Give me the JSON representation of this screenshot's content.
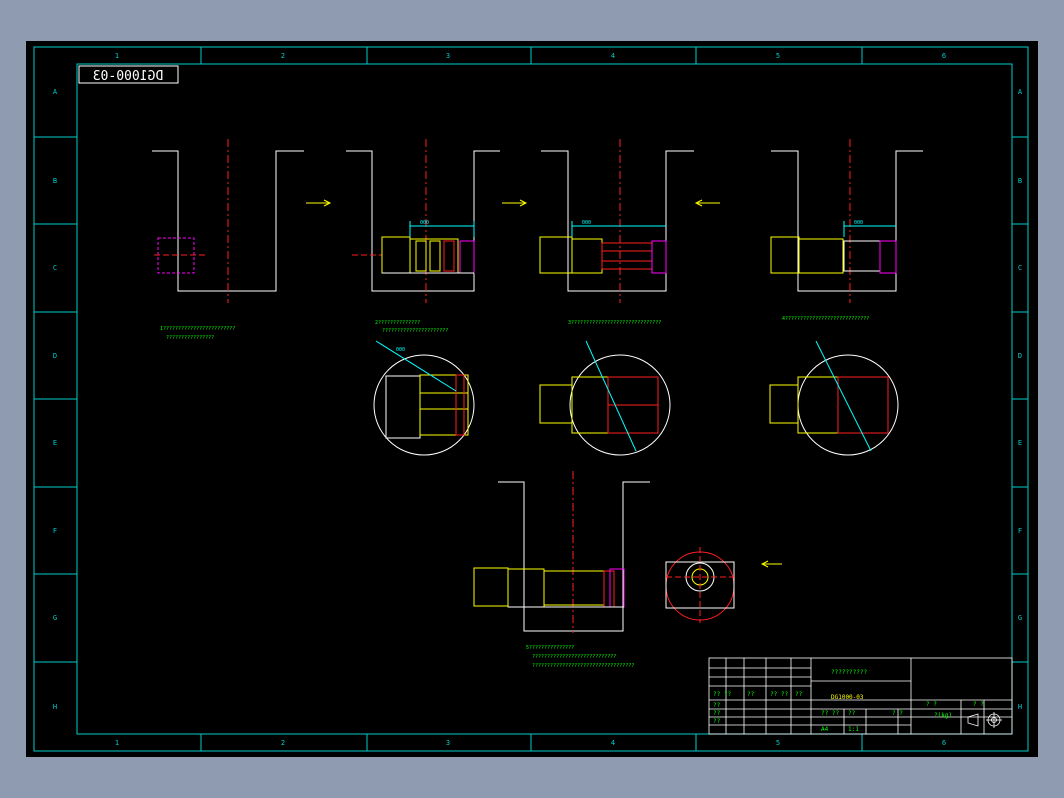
{
  "drawing": {
    "number_mirrored": "DG1000-03"
  },
  "frame": {
    "columns": [
      "1",
      "2",
      "3",
      "4",
      "5",
      "6"
    ],
    "rows": [
      "A",
      "B",
      "C",
      "D",
      "E",
      "F",
      "G",
      "H"
    ]
  },
  "notes": {
    "step1_line1": "1????????????????????????",
    "step1_line2": "????????????????",
    "step2_line1": "2??????????????",
    "step2_line2": "??????????????????????",
    "step3_line1": "3??????????????????????????????",
    "step4_line1": "4????????????????????????????",
    "step5_line1": "5???????????????",
    "step5_line2": "????????????????????????????",
    "step5_line3": "??????????????????????????????????"
  },
  "dimensions": {
    "d1": "000",
    "d2": "000",
    "d3": "000",
    "d4": "000"
  },
  "title_block": {
    "name": "??????????",
    "code": "DG1000-03",
    "left_labels": [
      "?? ??",
      "??",
      "?? ??",
      "??",
      "??",
      "??",
      "??"
    ],
    "stage_labels": [
      "?? ??",
      "??",
      "?  ?"
    ],
    "sheet_labels": [
      "?  ?",
      "?  ?"
    ],
    "mass": "?(kg)",
    "scale": "1:1",
    "paper": "A4"
  },
  "colors": {
    "frame": "#00cccc",
    "structure": "#ffffff",
    "centerline": "#ff2020",
    "machine": "#ffff00",
    "dimension": "#00ffff",
    "text": "#00ff00",
    "marker": "#ff00ff",
    "background": "#000000"
  }
}
